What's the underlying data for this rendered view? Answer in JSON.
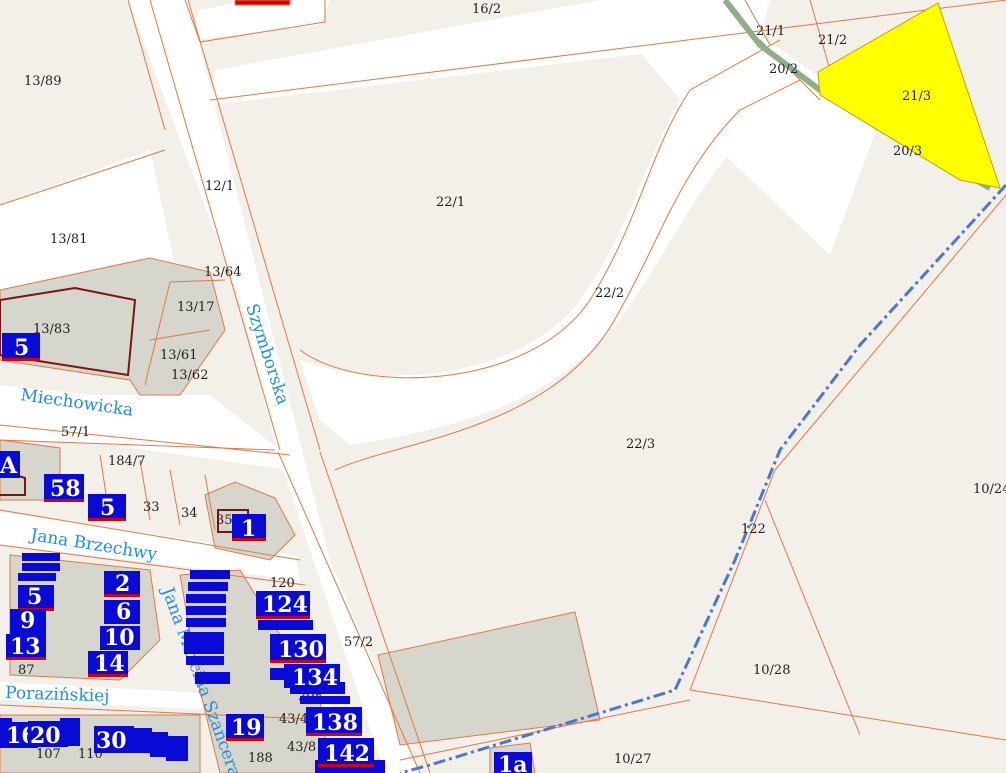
{
  "colors": {
    "background": "#f3efe9",
    "road": "#ffffff",
    "parcel_line": "#e07a45",
    "highlight": "#ffff00",
    "building_block": "#d6d6cc",
    "house_number_bg": "#0a0ad6",
    "house_number_underline": "#d40000",
    "street_label": "#1f8fe0",
    "boundary": "#4a78d0"
  },
  "parcels": [
    "16/2",
    "13/89",
    "21/1",
    "21/2",
    "20/2",
    "21/3",
    "20/3",
    "22/1",
    "12/1",
    "13/81",
    "13/64",
    "13/17",
    "13/83",
    "13/61",
    "13/62",
    "22/2",
    "57/1",
    "184/7",
    "22/3",
    "33",
    "34",
    "35",
    "10/24",
    "122",
    "120",
    "57/2",
    "87",
    "10/28",
    "208",
    "43/4",
    "43/8",
    "188",
    "110",
    "107",
    "10/27"
  ],
  "streets": [
    "Szymborska",
    "Miechowicka",
    "Jana Brzechwy",
    "Jana Marcina Szancera",
    "Porazińskiej"
  ],
  "house_numbers": [
    "5",
    "58",
    "5",
    "1",
    "2",
    "5",
    "6",
    "9",
    "10",
    "13",
    "14",
    "124",
    "130",
    "134",
    "138",
    "142",
    "19",
    "16",
    "20",
    "30",
    "1a"
  ],
  "fragments": [
    "A",
    "10",
    "1"
  ]
}
